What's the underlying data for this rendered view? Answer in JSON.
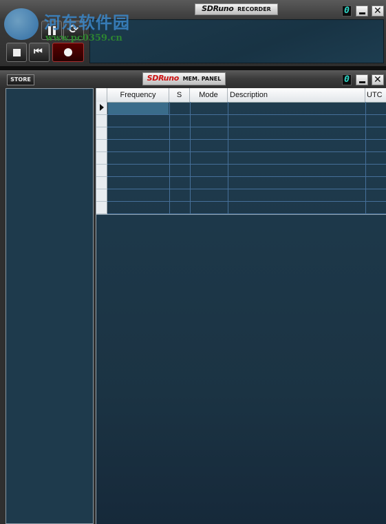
{
  "recorder": {
    "brand": "SDRuno",
    "title": "RECORDER",
    "digit": "0"
  },
  "watermark": {
    "text": "河东软件园",
    "url": "www.pc0359.cn"
  },
  "mem_panel": {
    "brand": "SDRuno",
    "title": "MEM. PANEL",
    "digit": "0",
    "store_label": "STORE",
    "columns": [
      "Frequency",
      "S",
      "Mode",
      "Description",
      "UTC"
    ],
    "rows": 9
  },
  "colors": {
    "accent": "#2fd6c7",
    "brand_red": "#cc1111",
    "panel_bg": "#1e3a4c",
    "selected_cell": "#3a6c8a"
  }
}
